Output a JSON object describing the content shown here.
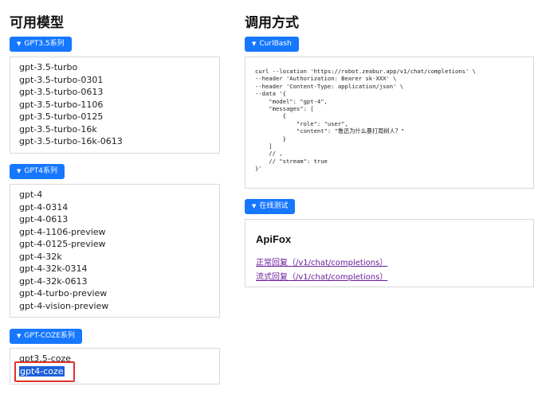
{
  "models_section": {
    "title": "可用模型",
    "groups": [
      {
        "button_label": "GPT3.5系列",
        "items": [
          "gpt-3.5-turbo",
          "gpt-3.5-turbo-0301",
          "gpt-3.5-turbo-0613",
          "gpt-3.5-turbo-1106",
          "gpt-3.5-turbo-0125",
          "gpt-3.5-turbo-16k",
          "gpt-3.5-turbo-16k-0613"
        ]
      },
      {
        "button_label": "GPT4系列",
        "items": [
          "gpt-4",
          "gpt-4-0314",
          "gpt-4-0613",
          "gpt-4-1106-preview",
          "gpt-4-0125-preview",
          "gpt-4-32k",
          "gpt-4-32k-0314",
          "gpt-4-32k-0613",
          "gpt-4-turbo-preview",
          "gpt-4-vision-preview"
        ]
      },
      {
        "button_label": "GPT-COZE系列",
        "items": [
          "gpt3.5-coze",
          "gpt4-coze"
        ],
        "selected_item": "gpt4-coze"
      }
    ]
  },
  "usage_section": {
    "title": "调用方式",
    "curl_button_label": "CurlBash",
    "curl_code": "curl --location 'https://robot.zeabur.app/v1/chat/completions' \\\n--header 'Authorization: Bearer sk-XXX' \\\n--header 'Content-Type: application/json' \\\n--data '{\n    \"model\": \"gpt-4\",\n    \"messages\": [\n        {\n            \"role\": \"user\",\n            \"content\": \"鲁迅为什么暴打周树人？\"\n        }\n    ]\n    // ,\n    // \"stream\": true\n}'",
    "online_test_button_label": "在线测试",
    "apifox": {
      "title": "ApiFox",
      "links": [
        "正常回复（/v1/chat/completions）",
        "流式回复（/v1/chat/completions）"
      ]
    }
  },
  "colors": {
    "accent": "#1677ff",
    "selection": "#1e5fd8",
    "annotation": "#e0302c",
    "link": "#6a1b9a"
  },
  "icons": {
    "dropdown": "caret-down-icon"
  }
}
